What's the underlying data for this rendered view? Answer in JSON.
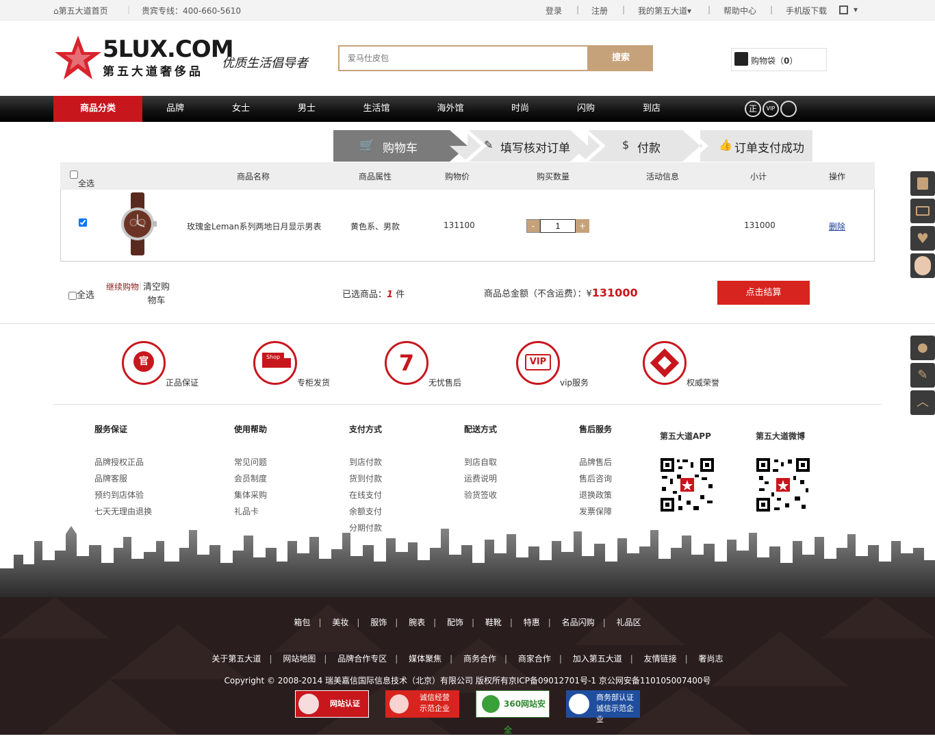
{
  "topbar": {
    "home": "第五大道首页",
    "hotline": "贵宾专线：400-660-5610",
    "login": "登录",
    "register": "注册",
    "my_account": "我的第五大道",
    "help": "帮助中心",
    "mobile": "手机版下载"
  },
  "header": {
    "logo_text": "5LUX.COM",
    "logo_sub": "第五大道奢侈品",
    "slogan": "优质生活倡导者",
    "search_placeholder": "爱马仕皮包",
    "search_button": "搜索",
    "cart_label": "购物袋（",
    "cart_count": "0",
    "cart_close": "）"
  },
  "nav": {
    "items": [
      "商品分类",
      "品牌",
      "女士",
      "男士",
      "生活馆",
      "海外馆",
      "时尚",
      "闪购",
      "到店"
    ],
    "badges": [
      "正",
      "VIP"
    ]
  },
  "steps": [
    "购物车",
    "填写核对订单",
    "付款",
    "订单支付成功"
  ],
  "cart": {
    "headers": {
      "select_all": "全选",
      "name": "商品名称",
      "attr": "商品属性",
      "price": "购物价",
      "qty": "购买数量",
      "promo": "活动信息",
      "subtotal": "小计",
      "ops": "操作"
    },
    "items": [
      {
        "name": "玫瑰金Leman系列两地日月显示男表",
        "attr": "黄色系、男款",
        "price": "131100",
        "qty": "1",
        "subtotal": "131000",
        "delete": "删除",
        "checked": true
      }
    ],
    "summary": {
      "select_all": "全选",
      "continue": "继续购物",
      "clear": "清空购物车",
      "selected_label": "已选商品：",
      "selected_count": "1",
      "selected_unit": "件",
      "total_label": "商品总金额（不含运费）：¥",
      "total": "131000",
      "checkout": "点击结算"
    }
  },
  "services": [
    "正品保证",
    "专柜发货",
    "无忧售后",
    "vip服务",
    "权威荣誉"
  ],
  "service_icons": [
    "官",
    "Shop",
    "7",
    "VIP",
    ""
  ],
  "footer_cols": [
    {
      "title": "服务保证",
      "items": [
        "品牌授权正品",
        "品牌客服",
        "预约到店体验",
        "七天无理由退换"
      ]
    },
    {
      "title": "使用帮助",
      "items": [
        "常见问题",
        "会员制度",
        "集体采购",
        "礼品卡"
      ]
    },
    {
      "title": "支付方式",
      "items": [
        "到店付款",
        "货到付款",
        "在线支付",
        "余额支付",
        "分期付款"
      ]
    },
    {
      "title": "配送方式",
      "items": [
        "到店自取",
        "运费说明",
        "验货签收"
      ]
    },
    {
      "title": "售后服务",
      "items": [
        "品牌售后",
        "售后咨询",
        "退换政策",
        "发票保障"
      ]
    }
  ],
  "qr": {
    "app": "第五大道APP",
    "weibo": "第五大道微博"
  },
  "footer": {
    "cats": [
      "箱包",
      "美妆",
      "服饰",
      "腕表",
      "配饰",
      "鞋靴",
      "特惠",
      "名品闪购",
      "礼品区"
    ],
    "links": [
      "关于第五大道",
      "网站地图",
      "品牌合作专区",
      "媒体聚焦",
      "商务合作",
      "商家合作",
      "加入第五大道",
      "友情链接",
      "奢尚志"
    ],
    "copyright": "Copyright © 2008-2014 瑞美嘉信国际信息技术（北京）有限公司 版权所有京ICP备09012701号-1 京公网安备110105007400号",
    "badges": [
      "网站认证",
      "诚信经营示范企业",
      "360网站安全",
      "商务部认证诚信示范企业"
    ]
  },
  "colors": {
    "accent": "#c8161d",
    "gold": "#c6a27a",
    "dark": "#2a1d1d"
  }
}
